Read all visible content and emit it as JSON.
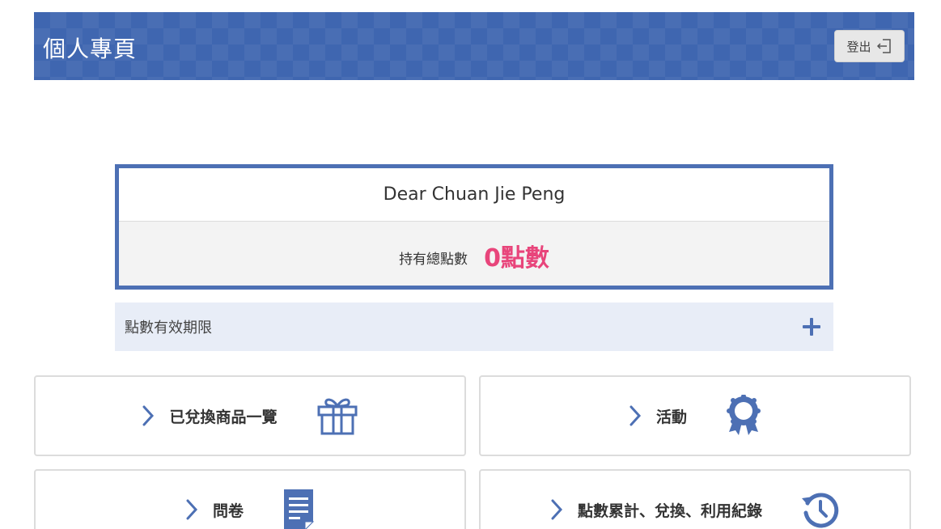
{
  "header": {
    "title": "個人專頁",
    "logout_label": "登出"
  },
  "points_card": {
    "greeting": "Dear Chuan Jie Peng",
    "points_label": "持有總點數",
    "points_value": "0點數"
  },
  "expiry": {
    "label": "點數有效期限"
  },
  "menu": [
    {
      "label": "已兌換商品一覽",
      "icon": "gift-icon"
    },
    {
      "label": "活動",
      "icon": "award-ribbon-icon"
    },
    {
      "label": "問卷",
      "icon": "document-icon"
    },
    {
      "label": "點數累計、兌換、利用紀錄",
      "icon": "history-icon"
    }
  ],
  "colors": {
    "header_bg": "#3f66b0",
    "accent_blue": "#4d70b4",
    "points_pink": "#e8457b",
    "expiry_bg": "#e8edf7"
  }
}
